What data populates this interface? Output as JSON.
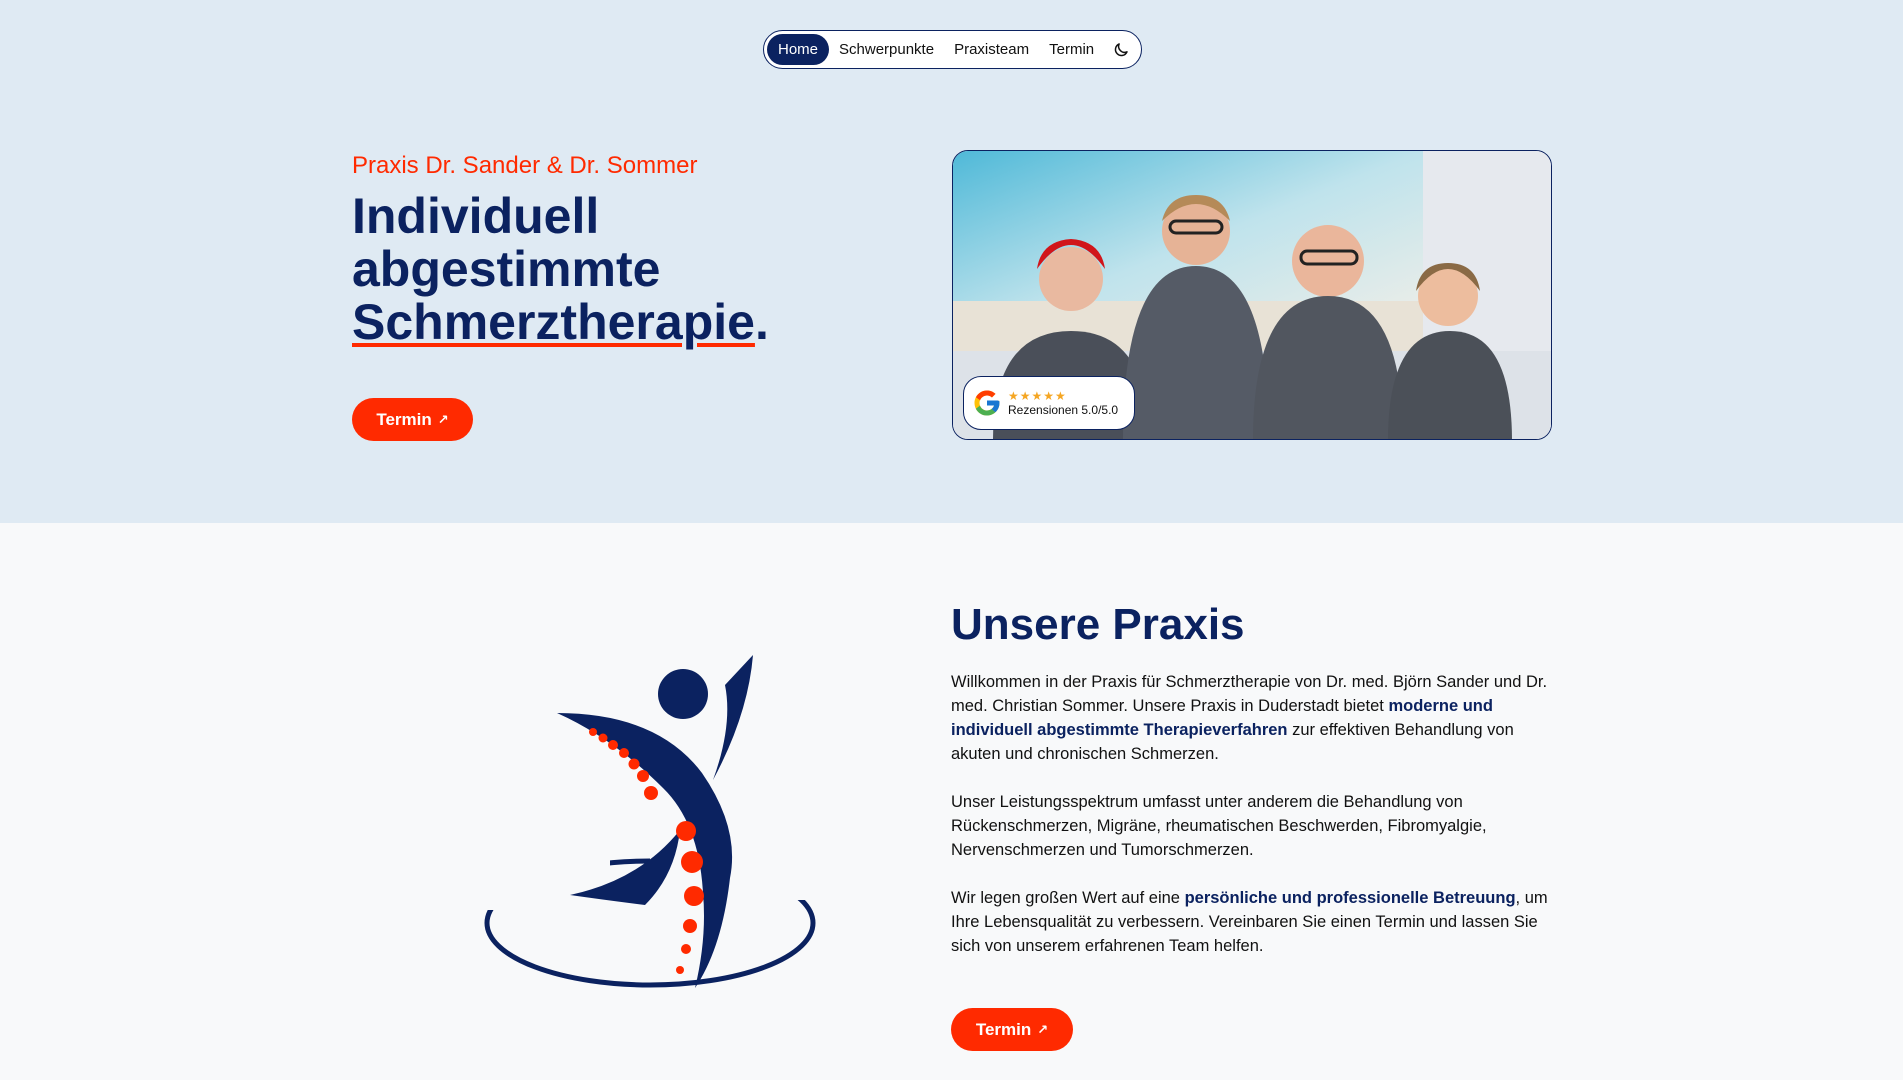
{
  "nav": {
    "items": [
      {
        "label": "Home",
        "active": true
      },
      {
        "label": "Schwerpunkte",
        "active": false
      },
      {
        "label": "Praxisteam",
        "active": false
      },
      {
        "label": "Termin",
        "active": false
      }
    ],
    "theme_icon": "moon-icon"
  },
  "hero": {
    "subtitle": "Praxis Dr. Sander & Dr. Sommer",
    "title_line1": "Individuell",
    "title_line2": "abgestimmte",
    "title_underlined": "Schmerztherapie",
    "title_end": ".",
    "button_label": "Termin",
    "review_stars": "★★★★★",
    "review_text": "Rezensionen 5.0/5.0"
  },
  "section": {
    "title": "Unsere Praxis",
    "p1_a": "Willkommen in der Praxis für Schmerztherapie von Dr. med. Björn Sander und Dr. med. Christian Sommer. Unsere Praxis in Duderstadt bietet ",
    "p1_b": "moderne und individuell abgestimmte Therapieverfahren",
    "p1_c": " zur effektiven Behandlung von akuten und chronischen Schmerzen.",
    "p2": "Unser Leistungsspektrum umfasst unter anderem die Behandlung von Rückenschmerzen, Migräne, rheumatischen Beschwerden, Fibromyalgie, Nervenschmerzen und Tumorschmerzen.",
    "p3_a": "Wir legen großen Wert auf eine ",
    "p3_b": "persönliche und professionelle Betreuung",
    "p3_c": ", um Ihre Lebensqualität zu verbessern. Vereinbaren Sie einen Termin und lassen Sie sich von unserem erfahrenen Team helfen.",
    "button_label": "Termin"
  },
  "colors": {
    "navy": "#0b2260",
    "accent": "#ff2a00",
    "hero_bg": "#dfeaf3"
  }
}
